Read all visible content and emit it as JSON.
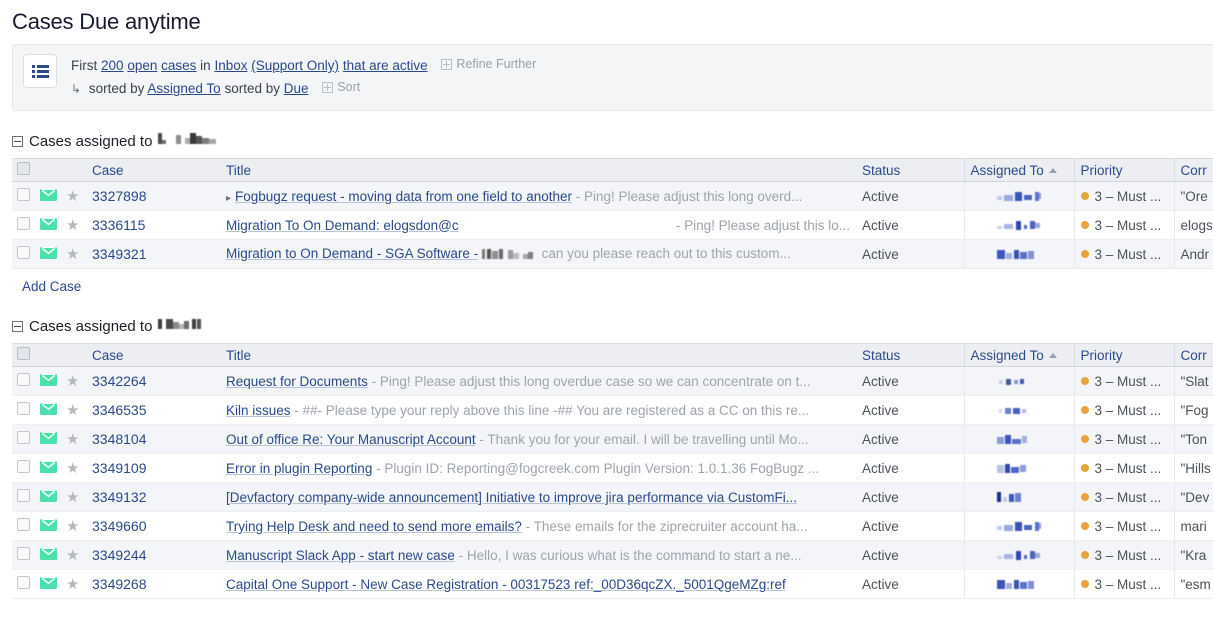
{
  "page": {
    "title": "Cases Due anytime"
  },
  "filter_bar": {
    "icon": "list-filter-icon",
    "line1": {
      "prefix": "First",
      "count_link": "200",
      "open_link": "open",
      "cases_link": "cases",
      "in_word": "in",
      "inbox_link": "Inbox",
      "support_only_link": "(Support Only)",
      "active_link": "that are active",
      "refine_label": "Refine Further"
    },
    "line2": {
      "arrow": "↳",
      "sorted_by_1": "sorted by",
      "sort_field_1": "Assigned To",
      "sorted_by_2": "sorted by",
      "sort_field_2": "Due",
      "sort_label": "Sort"
    }
  },
  "columns": {
    "case": "Case",
    "title": "Title",
    "status": "Status",
    "assigned_to": "Assigned To",
    "priority": "Priority",
    "correspondent": "Corr"
  },
  "groups": [
    {
      "label": "Cases assigned to",
      "assignee_redacted": true,
      "add_case_label": "Add Case",
      "rows": [
        {
          "case": "3327898",
          "expandable": true,
          "title": "Fogbugz request - moving data from one field to another",
          "snippet": "- Ping! Please adjust this long overd...",
          "split": false,
          "status": "Active",
          "priority": "3 – Must ...",
          "correspondent": "\"Ore"
        },
        {
          "case": "3336115",
          "expandable": false,
          "title": "Migration To On Demand: elogsdon@c",
          "snippet": "- Ping! Please adjust this lo...",
          "split": true,
          "status": "Active",
          "priority": "3 – Must ...",
          "correspondent": "elogs"
        },
        {
          "case": "3349321",
          "expandable": false,
          "title": "Migration to On Demand - SGA Software -",
          "snippet": "can you please reach out to this custom...",
          "snippet_redacted": true,
          "split": false,
          "status": "Active",
          "priority": "3 – Must ...",
          "correspondent": "Andr"
        }
      ]
    },
    {
      "label": "Cases assigned to",
      "assignee_redacted": true,
      "rows": [
        {
          "case": "3342264",
          "title": "Request for Documents",
          "snippet": "- Ping! Please adjust this long overdue case so we can concentrate on t...",
          "status": "Active",
          "priority": "3 – Must ...",
          "correspondent": "\"Slat"
        },
        {
          "case": "3346535",
          "title": "Kiln issues",
          "snippet": "- ##- Please type your reply above this line -## You are registered as a CC on this re...",
          "status": "Active",
          "priority": "3 – Must ...",
          "correspondent": "\"Fog"
        },
        {
          "case": "3348104",
          "title": "Out of office Re: Your Manuscript Account",
          "snippet": "- Thank you for your email. I will be travelling until Mo...",
          "status": "Active",
          "priority": "3 – Must ...",
          "correspondent": "\"Ton"
        },
        {
          "case": "3349109",
          "title": "Error in plugin Reporting",
          "snippet": "- Plugin ID: Reporting@fogcreek.com Plugin Version: 1.0.1.36 FogBugz ...",
          "status": "Active",
          "priority": "3 – Must ...",
          "correspondent": "\"Hills"
        },
        {
          "case": "3349132",
          "title": "[Devfactory company-wide announcement] Initiative to improve jira performance via CustomFi...",
          "snippet": "",
          "status": "Active",
          "priority": "3 – Must ...",
          "correspondent": "\"Dev"
        },
        {
          "case": "3349660",
          "title": "Trying Help Desk and need to send more emails?",
          "snippet": "- These emails for the ziprecruiter account ha...",
          "status": "Active",
          "priority": "3 – Must ...",
          "correspondent": "mari"
        },
        {
          "case": "3349244",
          "title": "Manuscript Slack App - start new case",
          "snippet": "- Hello, I was curious what is the command to start a ne...",
          "status": "Active",
          "priority": "3 – Must ...",
          "correspondent": "\"Kra"
        },
        {
          "case": "3349268",
          "title": "Capital One Support - New Case Registration - 00317523 ref:_00D36qcZX._5001QgeMZg:ref",
          "snippet": "",
          "status": "Active",
          "priority": "3 – Must ...",
          "correspondent": "\"esm"
        }
      ]
    }
  ],
  "colors": {
    "link": "#2b4a8b",
    "priority_dot": "#e8a33d",
    "envelope": "#4ce0ad",
    "header_bg": "#eceef2",
    "alt_row_bg": "#f4f5f8"
  },
  "icons": {
    "envelope": "envelope-icon",
    "star": "star-icon",
    "checkbox": "checkbox",
    "expander": "▸",
    "sort_ascending": "▲"
  }
}
